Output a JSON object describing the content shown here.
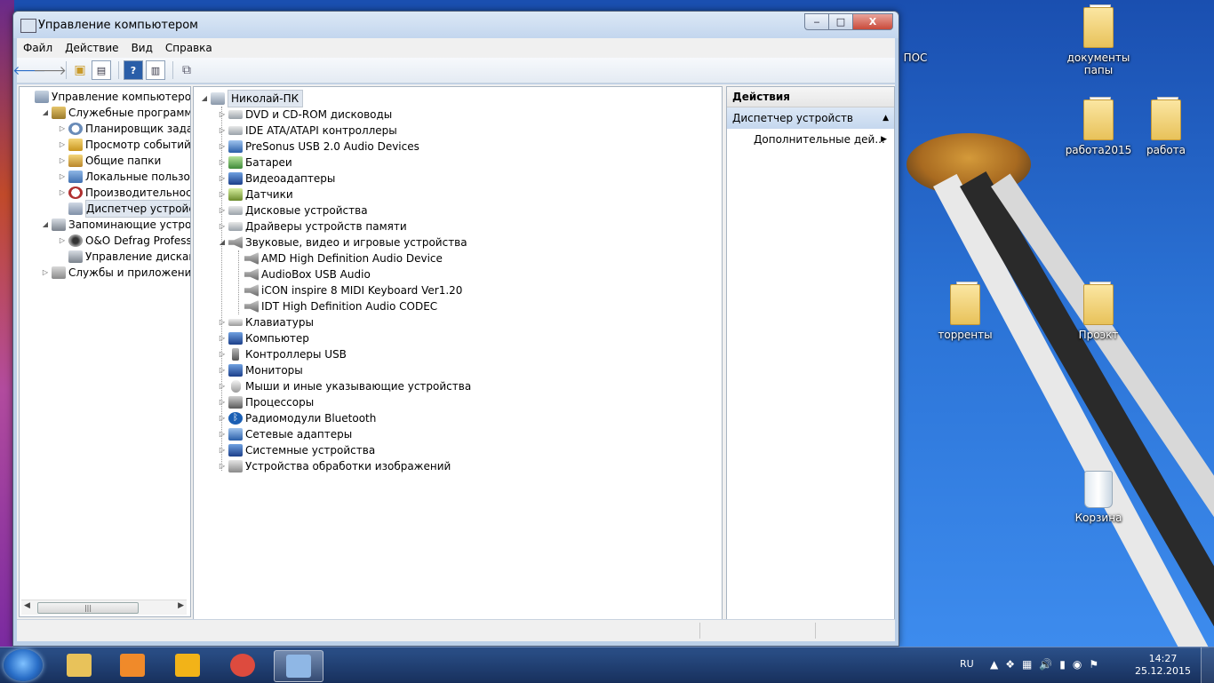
{
  "window": {
    "title": "Управление компьютером",
    "caption": {
      "minimize": "‒",
      "maximize": "□",
      "close": "X"
    }
  },
  "menu": [
    "Файл",
    "Действие",
    "Вид",
    "Справка"
  ],
  "left_tree": [
    {
      "label": "Управление компьютером (л",
      "indent": 0,
      "expander": "",
      "icon": "computer-management-icon",
      "color": "c-comp"
    },
    {
      "label": "Служебные программы",
      "indent": 1,
      "expander": "◢",
      "icon": "tools-icon",
      "color": "c-tools"
    },
    {
      "label": "Планировщик заданий",
      "indent": 2,
      "expander": "▷",
      "icon": "clock-icon",
      "color": "c-clock"
    },
    {
      "label": "Просмотр событий",
      "indent": 2,
      "expander": "▷",
      "icon": "event-viewer-icon",
      "color": "c-event"
    },
    {
      "label": "Общие папки",
      "indent": 2,
      "expander": "▷",
      "icon": "shared-folders-icon",
      "color": "c-share"
    },
    {
      "label": "Локальные пользовате",
      "indent": 2,
      "expander": "▷",
      "icon": "users-icon",
      "color": "c-users"
    },
    {
      "label": "Производительность",
      "indent": 2,
      "expander": "▷",
      "icon": "performance-icon",
      "color": "c-perf"
    },
    {
      "label": "Диспетчер устройств",
      "indent": 2,
      "expander": "",
      "icon": "device-manager-icon",
      "color": "c-dev",
      "selected": true
    },
    {
      "label": "Запоминающие устройст",
      "indent": 1,
      "expander": "◢",
      "icon": "storage-icon",
      "color": "c-disk"
    },
    {
      "label": "O&O Defrag Profession",
      "indent": 2,
      "expander": "▷",
      "icon": "defrag-icon",
      "color": "c-defrag"
    },
    {
      "label": "Управление дисками",
      "indent": 2,
      "expander": "",
      "icon": "disk-management-icon",
      "color": "c-disk"
    },
    {
      "label": "Службы и приложения",
      "indent": 1,
      "expander": "▷",
      "icon": "services-icon",
      "color": "c-svc"
    }
  ],
  "device_root": "Николай-ПК",
  "device_tree": [
    {
      "label": "DVD и CD-ROM дисководы",
      "level": 1,
      "expander": "▷",
      "icon": "dvd-drive-icon",
      "color": "c-drive"
    },
    {
      "label": "IDE ATA/ATAPI контроллеры",
      "level": 1,
      "expander": "▷",
      "icon": "ide-controller-icon",
      "color": "c-drive"
    },
    {
      "label": "PreSonus USB 2.0 Audio Devices",
      "level": 1,
      "expander": "▷",
      "icon": "audio-device-icon",
      "color": "c-net"
    },
    {
      "label": "Батареи",
      "level": 1,
      "expander": "▷",
      "icon": "battery-icon",
      "color": "c-bat"
    },
    {
      "label": "Видеоадаптеры",
      "level": 1,
      "expander": "▷",
      "icon": "display-adapter-icon",
      "color": "c-mon"
    },
    {
      "label": "Датчики",
      "level": 1,
      "expander": "▷",
      "icon": "sensor-icon",
      "color": "c-sensor"
    },
    {
      "label": "Дисковые устройства",
      "level": 1,
      "expander": "▷",
      "icon": "disk-drive-icon",
      "color": "c-drive"
    },
    {
      "label": "Драйверы устройств памяти",
      "level": 1,
      "expander": "▷",
      "icon": "memory-driver-icon",
      "color": "c-drive"
    },
    {
      "label": "Звуковые, видео и игровые устройства",
      "level": 1,
      "expander": "◢",
      "icon": "speaker-icon",
      "color": "c-audio"
    },
    {
      "label": "AMD High Definition Audio Device",
      "level": 2,
      "expander": "",
      "icon": "speaker-icon",
      "color": "c-audio"
    },
    {
      "label": "AudioBox USB Audio",
      "level": 2,
      "expander": "",
      "icon": "speaker-icon",
      "color": "c-audio"
    },
    {
      "label": "iCON inspire 8 MIDI Keyboard Ver1.20",
      "level": 2,
      "expander": "",
      "icon": "speaker-icon",
      "color": "c-audio"
    },
    {
      "label": "IDT High Definition Audio CODEC",
      "level": 2,
      "expander": "",
      "icon": "speaker-icon",
      "color": "c-audio"
    },
    {
      "label": "Клавиатуры",
      "level": 1,
      "expander": "▷",
      "icon": "keyboard-icon",
      "color": "c-kbd"
    },
    {
      "label": "Компьютер",
      "level": 1,
      "expander": "▷",
      "icon": "computer-icon",
      "color": "c-mon"
    },
    {
      "label": "Контроллеры USB",
      "level": 1,
      "expander": "▷",
      "icon": "usb-icon",
      "color": "c-usb"
    },
    {
      "label": "Мониторы",
      "level": 1,
      "expander": "▷",
      "icon": "monitor-icon",
      "color": "c-mon"
    },
    {
      "label": "Мыши и иные указывающие устройства",
      "level": 1,
      "expander": "▷",
      "icon": "mouse-icon",
      "color": "c-mouse"
    },
    {
      "label": "Процессоры",
      "level": 1,
      "expander": "▷",
      "icon": "processor-icon",
      "color": "c-cpu"
    },
    {
      "label": "Радиомодули Bluetooth",
      "level": 1,
      "expander": "▷",
      "icon": "bluetooth-icon",
      "color": "c-bt"
    },
    {
      "label": "Сетевые адаптеры",
      "level": 1,
      "expander": "▷",
      "icon": "network-adapter-icon",
      "color": "c-net"
    },
    {
      "label": "Системные устройства",
      "level": 1,
      "expander": "▷",
      "icon": "system-devices-icon",
      "color": "c-mon"
    },
    {
      "label": "Устройства обработки изображений",
      "level": 1,
      "expander": "▷",
      "icon": "imaging-device-icon",
      "color": "c-img"
    }
  ],
  "actions": {
    "header": "Действия",
    "group": "Диспетчер устройств",
    "item": "Дополнительные дей..."
  },
  "desktop_icons": [
    {
      "label": "документы папы",
      "kind": "folder"
    },
    {
      "label": "работа2015",
      "kind": "folder"
    },
    {
      "label": "работа",
      "kind": "folder"
    },
    {
      "label": "торренты",
      "kind": "folder"
    },
    {
      "label": "Проэкт",
      "kind": "folder"
    },
    {
      "label": "Корзина",
      "kind": "trash"
    },
    {
      "label": "ПОС",
      "kind": "partial"
    }
  ],
  "taskbar": {
    "apps": [
      {
        "name": "explorer-taskbar-button",
        "color": "#e8c25a"
      },
      {
        "name": "media-player-taskbar-button",
        "color": "#f08a2a"
      },
      {
        "name": "puzzle-app-taskbar-button",
        "color": "#f2b318"
      },
      {
        "name": "chrome-taskbar-button",
        "color": "#dd4b3e"
      },
      {
        "name": "computer-management-taskbar-button",
        "color": "#8fb7e5",
        "active": true
      }
    ],
    "language": "RU",
    "time": "14:27",
    "date": "25.12.2015"
  }
}
